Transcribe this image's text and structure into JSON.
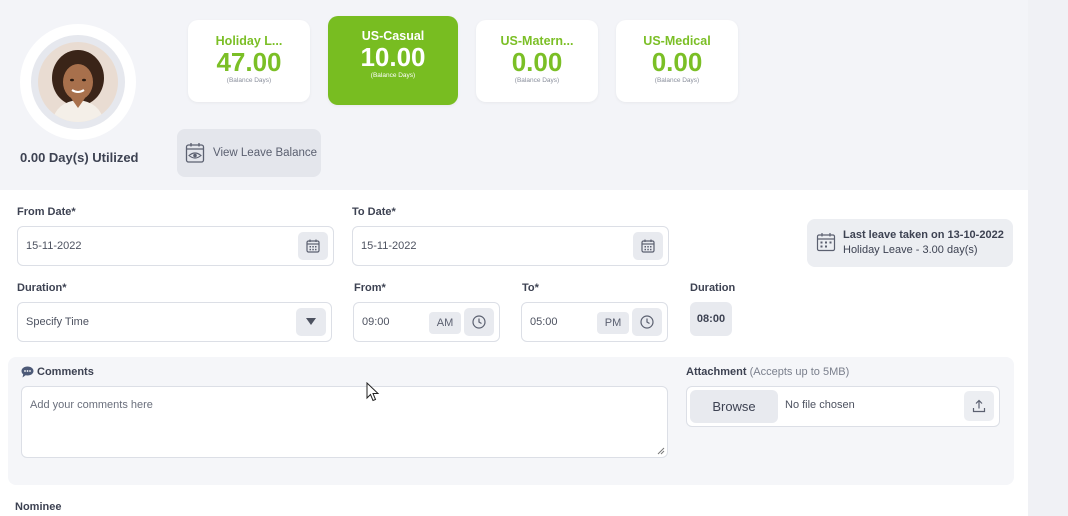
{
  "profile": {
    "utilized_label": "0.00 Day(s) Utilized"
  },
  "balances": [
    {
      "title": "Holiday L...",
      "value": "47.00",
      "sub": "(Balance Days)",
      "active": false
    },
    {
      "title": "US-Casual",
      "value": "10.00",
      "sub": "(Balance Days)",
      "active": true
    },
    {
      "title": "US-Matern...",
      "value": "0.00",
      "sub": "(Balance Days)",
      "active": false
    },
    {
      "title": "US-Medical",
      "value": "0.00",
      "sub": "(Balance Days)",
      "active": false
    }
  ],
  "view_leave_balance_label": "View Leave Balance",
  "form": {
    "from_date_label": "From Date*",
    "from_date_value": "15-11-2022",
    "to_date_label": "To Date*",
    "to_date_value": "15-11-2022",
    "duration_label": "Duration*",
    "duration_value": "Specify Time",
    "from_label": "From*",
    "from_value": "09:00",
    "from_ampm": "AM",
    "to_label": "To*",
    "to_value": "05:00",
    "to_ampm": "PM",
    "duration_total_label": "Duration",
    "duration_total_value": "08:00"
  },
  "last_leave": {
    "line1": "Last leave taken on 13-10-2022",
    "line2": "Holiday Leave - 3.00 day(s)"
  },
  "comments": {
    "label": "Comments",
    "placeholder": "Add your comments here"
  },
  "attachment": {
    "label": "Attachment",
    "hint": "(Accepts up to 5MB)",
    "browse_label": "Browse",
    "no_file_label": "No file chosen"
  },
  "nominee_label": "Nominee",
  "colors": {
    "accent_green": "#78bd21",
    "text_dark": "#3d4252"
  }
}
